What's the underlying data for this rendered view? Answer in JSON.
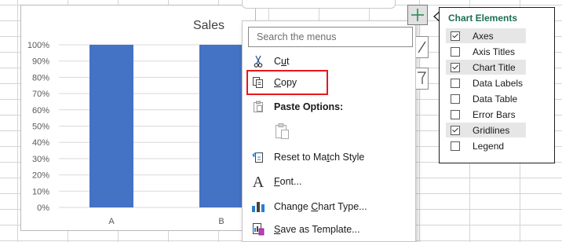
{
  "chart_data": {
    "type": "bar",
    "title": "Sales",
    "categories": [
      "A",
      "B"
    ],
    "values": [
      1.0,
      1.0
    ],
    "ylim": [
      0,
      1.0
    ],
    "yticks": [
      "0%",
      "10%",
      "20%",
      "30%",
      "40%",
      "50%",
      "60%",
      "70%",
      "80%",
      "90%",
      "100%"
    ],
    "grid": true,
    "bar_color": "#4472c4"
  },
  "context_menu": {
    "search_placeholder": "Search the menus",
    "items": {
      "cut": "Cut",
      "copy": "Copy",
      "paste_options": "Paste Options:",
      "reset": "Reset to Match Style",
      "font": "Font...",
      "change_chart_type": "Change Chart Type...",
      "save_template": "Save as Template..."
    },
    "highlight_color": "#e8171c"
  },
  "chart_elements": {
    "title": "Chart Elements",
    "title_color": "#1e6e52",
    "items": [
      {
        "label": "Axes",
        "checked": true
      },
      {
        "label": "Axis Titles",
        "checked": false
      },
      {
        "label": "Chart Title",
        "checked": true
      },
      {
        "label": "Data Labels",
        "checked": false
      },
      {
        "label": "Data Table",
        "checked": false
      },
      {
        "label": "Error Bars",
        "checked": false
      },
      {
        "label": "Gridlines",
        "checked": true
      },
      {
        "label": "Legend",
        "checked": false
      }
    ]
  }
}
